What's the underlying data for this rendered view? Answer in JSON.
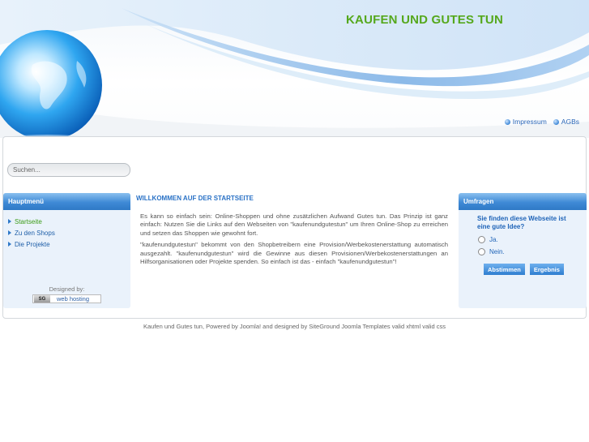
{
  "header": {
    "site_title": "KAUFEN UND GUTES TUN",
    "links": [
      {
        "label": "Impressum",
        "icon": "bullet-icon"
      },
      {
        "label": "AGBs",
        "icon": "bullet-icon"
      }
    ]
  },
  "search": {
    "placeholder": "Suchen..."
  },
  "left": {
    "heading": "Hauptmenü",
    "menu": [
      {
        "label": "Startseite",
        "active": true
      },
      {
        "label": "Zu den Shops",
        "active": false
      },
      {
        "label": "Die Projekte",
        "active": false
      }
    ],
    "designed_by": "Designed by:",
    "badge_logo": "SG",
    "badge_text": "web hosting"
  },
  "main": {
    "title": "WILLKOMMEN AUF DER STARTSEITE",
    "paragraphs": [
      "Es kann so einfach sein: Online-Shoppen und ohne zusätzlichen Aufwand Gutes tun. Das Prinzip ist ganz einfach: Nutzen Sie die Links auf den Webseiten von \"kaufenundgutestun\" um Ihren Online-Shop zu erreichen und setzen das Shoppen wie gewohnt fort.",
      "\"kaufenundgutestun\" bekommt von den Shopbetreibern eine Provision/Werbekostenerstattung automatisch ausgezahlt. \"kaufenundgutestun\" wird die Gewinne aus diesen Provisionen/Werbekostenerstattungen an Hilfsorganisationen oder Projekte spenden. So einfach ist das - einfach \"kaufenundgutestun\"!"
    ]
  },
  "poll": {
    "heading": "Umfragen",
    "question": "Sie finden diese Webseite ist eine gute Idee?",
    "options": [
      "Ja.",
      "Nein."
    ],
    "vote_label": "Abstimmen",
    "results_label": "Ergebnis"
  },
  "footer": {
    "text": "Kaufen und Gutes tun, Powered by Joomla! and designed by SiteGround Joomla Templates valid xhtml valid css"
  },
  "colors": {
    "title_green": "#55a81c",
    "link_blue": "#2a66b8",
    "box_header_blue": "#3f8ad6",
    "box_bg": "#eaf2fb"
  }
}
